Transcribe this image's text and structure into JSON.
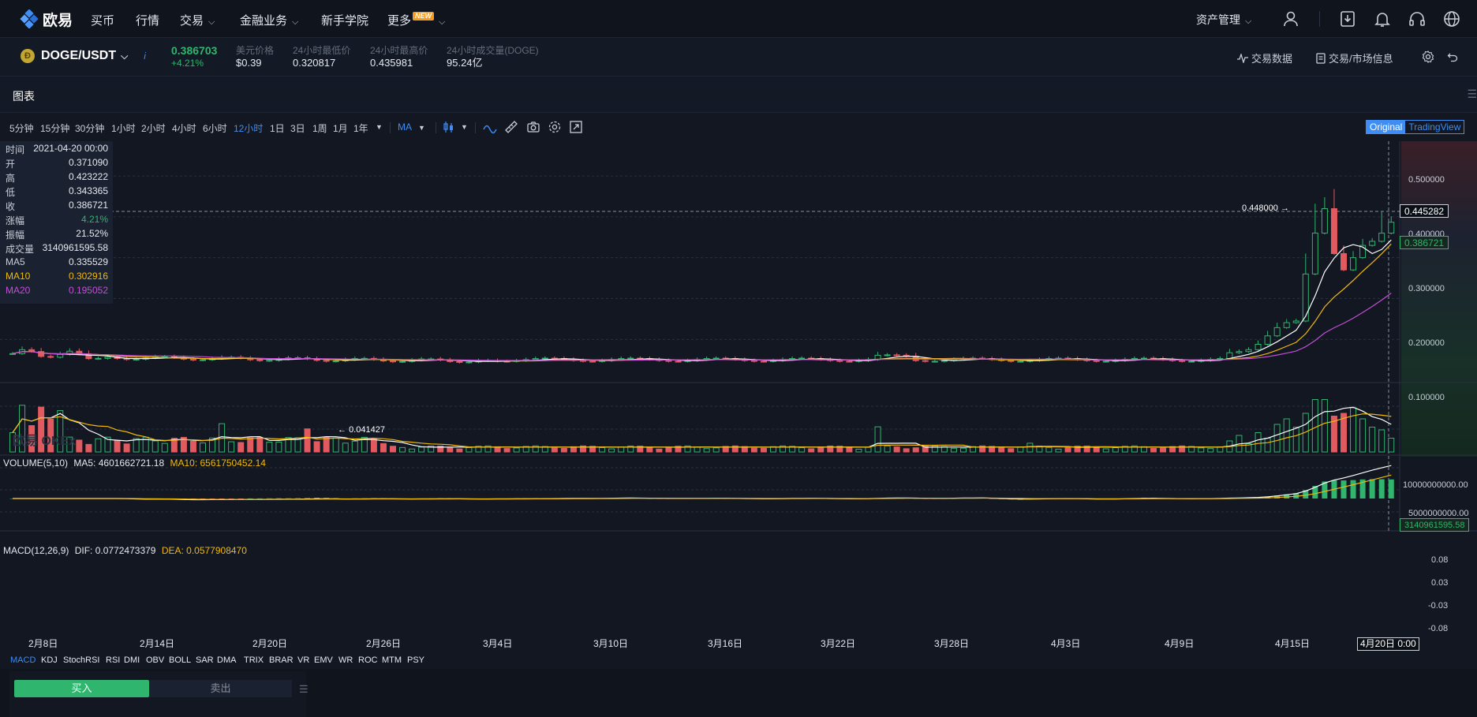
{
  "nav": {
    "logo": "欧易",
    "items": [
      "买币",
      "行情",
      "交易",
      "金融业务",
      "新手学院",
      "更多"
    ],
    "new_badge": "NEW",
    "asset_mgmt": "资产管理"
  },
  "ticker": {
    "pair": "DOGE/USDT",
    "price": "0.386703",
    "change": "+4.21%",
    "usd_label": "美元价格",
    "usd_value": "$0.39",
    "low_label": "24小时最低价",
    "low_value": "0.320817",
    "high_label": "24小时最高价",
    "high_value": "0.435981",
    "vol_label": "24小时成交量(DOGE)",
    "vol_value": "95.24亿",
    "trade_data": "交易数据",
    "market_info": "交易/市场信息"
  },
  "panel": {
    "title": "图表"
  },
  "toolbar": {
    "timeframes": [
      "5分钟",
      "15分钟",
      "30分钟",
      "1小时",
      "2小时",
      "4小时",
      "6小时",
      "12小时",
      "1日",
      "3日",
      "1周",
      "1月",
      "1年"
    ],
    "active_timeframe": "12小时",
    "ma_label": "MA",
    "mode_original": "Original",
    "mode_tv": "TradingView"
  },
  "ohlc": {
    "time_label": "时间",
    "time_value": "2021-04-20 00:00",
    "rows": [
      {
        "k": "开",
        "v": "0.371090"
      },
      {
        "k": "高",
        "v": "0.423222"
      },
      {
        "k": "低",
        "v": "0.343365"
      },
      {
        "k": "收",
        "v": "0.386721"
      },
      {
        "k": "涨幅",
        "v": "4.21%"
      },
      {
        "k": "振幅",
        "v": "21.52%"
      },
      {
        "k": "成交量",
        "v": "3140961595.58"
      },
      {
        "k": "MA5",
        "v": "0.335529"
      },
      {
        "k": "MA10",
        "v": "0.302916"
      },
      {
        "k": "MA20",
        "v": "0.195052"
      }
    ]
  },
  "chart_data": {
    "type": "candlestick",
    "y_ticks": [
      "0.500000",
      "0.400000",
      "0.300000",
      "0.200000",
      "0.100000"
    ],
    "ylim": [
      0,
      0.56
    ],
    "x_labels": [
      "2月8日",
      "2月14日",
      "2月20日",
      "2月26日",
      "3月4日",
      "3月10日",
      "3月16日",
      "3月22日",
      "3月28日",
      "4月3日",
      "4月9日",
      "4月15日"
    ],
    "crosshair_date": "4月20日 0:00",
    "max_marker": "0.448000",
    "min_marker": "0.041427",
    "crosshair_price": "0.445282",
    "last_price": "0.386721",
    "watermark": "欧易 OKEx",
    "volume": {
      "title": "VOLUME(5,10)",
      "ma5": "MA5: 4601662721.18",
      "ma10": "MA10: 6561750452.14",
      "y_ticks": [
        "10000000000.00",
        "5000000000.00"
      ],
      "last": "3140961595.58"
    },
    "macd": {
      "title": "MACD(12,26,9)",
      "dif": "DIF: 0.0772473379",
      "dea": "DEA: 0.0577908470",
      "y_ticks": [
        "0.08",
        "0.03",
        "-0.03",
        "-0.08"
      ]
    }
  },
  "indicators": [
    "MACD",
    "KDJ",
    "StochRSI",
    "RSI",
    "DMI",
    "OBV",
    "BOLL",
    "SAR",
    "DMA",
    "TRIX",
    "BRAR",
    "VR",
    "EMV",
    "WR",
    "ROC",
    "MTM",
    "PSY"
  ],
  "trade": {
    "buy": "买入",
    "sell": "卖出"
  },
  "colors": {
    "up": "#2fb56d",
    "down": "#e05a5f",
    "accent": "#3d8df5",
    "ma5": "#ffffff",
    "ma10": "#f0b90b",
    "ma20": "#c44fd6"
  }
}
